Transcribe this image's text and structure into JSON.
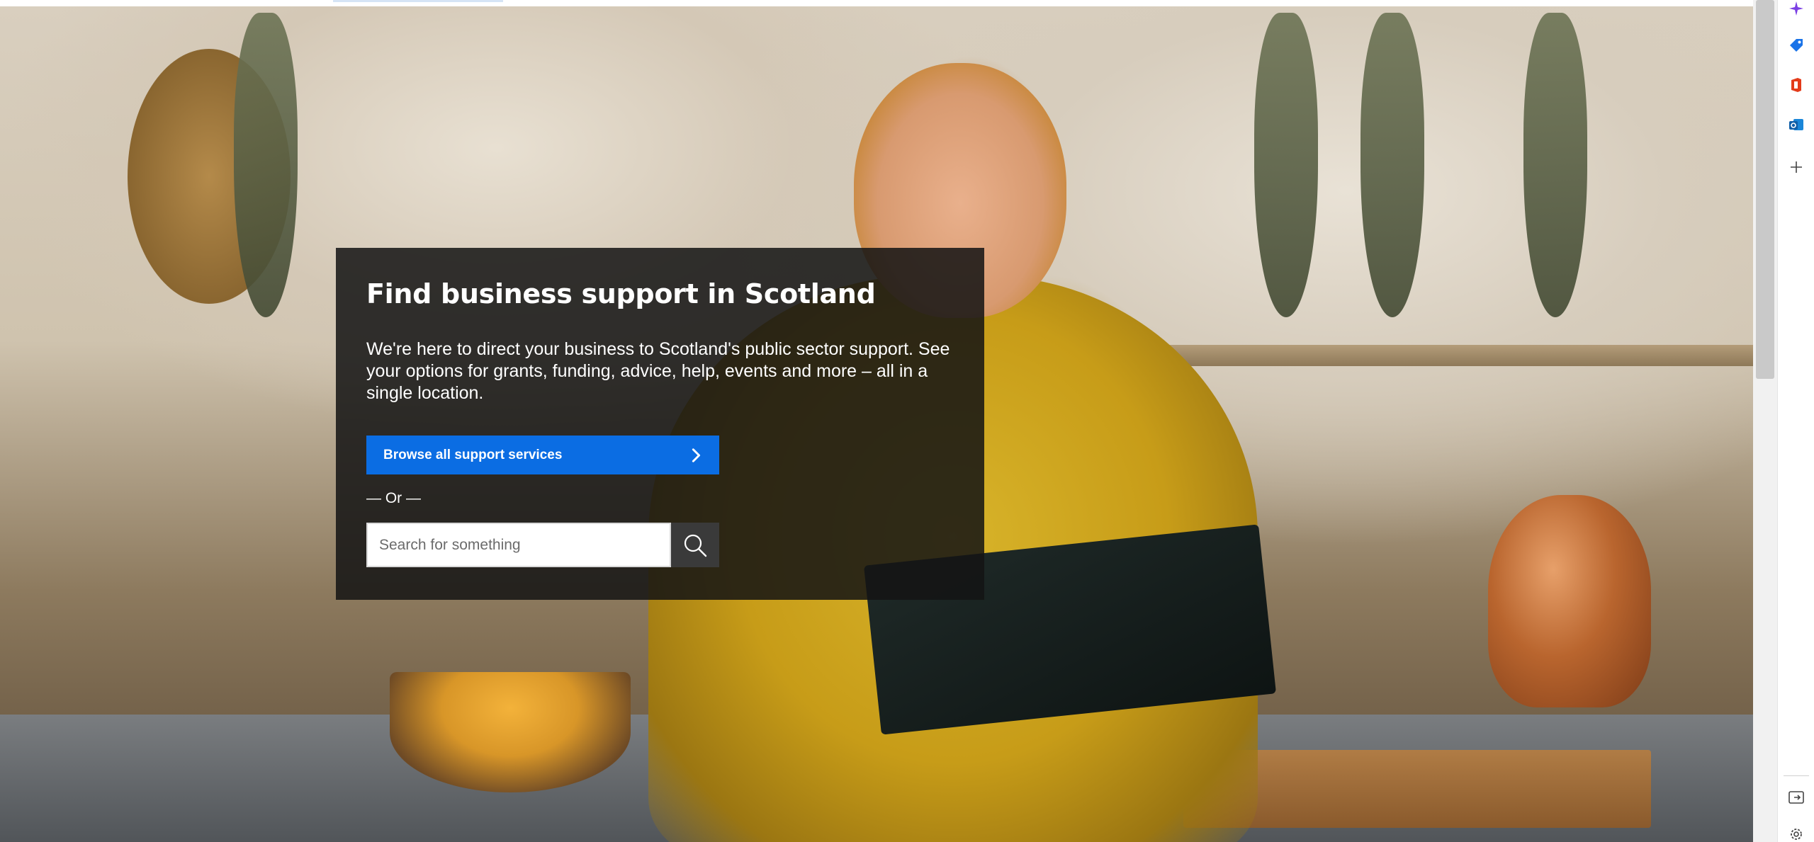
{
  "hero": {
    "title": "Find business support in Scotland",
    "description": "We're here to direct your business to Scotland's public sector support. See your options for grants, funding, advice, help, events and more – all in a single location.",
    "browse_button_label": "Browse all support services",
    "or_text": "— Or —",
    "search": {
      "placeholder": "Search for something",
      "value": ""
    }
  },
  "sidebar": {
    "icons": [
      "copilot-icon",
      "shopping-tag-icon",
      "office-icon",
      "outlook-icon",
      "add-icon",
      "sidebar-toggle-icon",
      "settings-icon"
    ]
  },
  "colors": {
    "button_blue": "#0b6de3",
    "card_bg": "rgba(20,20,20,0.86)",
    "search_button": "#3a3a3a"
  }
}
